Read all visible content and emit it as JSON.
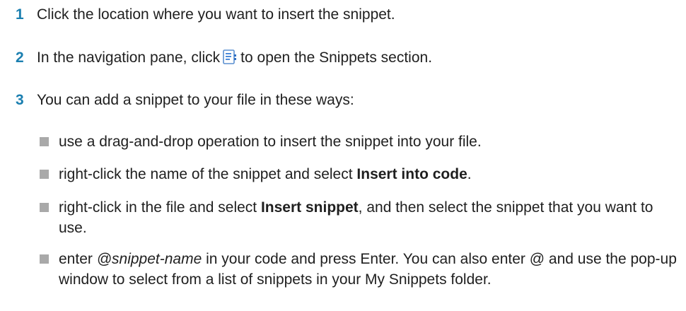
{
  "steps": [
    {
      "number": "1",
      "text": "Click the location where you want to insert the snippet."
    },
    {
      "number": "2",
      "text_before": "In the navigation pane, click",
      "icon": "snippets-icon",
      "text_after": "to open the Snippets section."
    },
    {
      "number": "3",
      "text": "You can add a snippet to your file in these ways:"
    }
  ],
  "ways": [
    {
      "text": "use a drag-and-drop operation to insert the snippet into your file."
    },
    {
      "text_before": "right-click the name of the snippet and select ",
      "bold": "Insert into code",
      "text_after": "."
    },
    {
      "text_before": "right-click in the file and select ",
      "bold": "Insert snippet",
      "text_after": ", and then select the snippet that you want to use."
    },
    {
      "italic": "@snippet-name",
      "text_before": "enter ",
      "text_after": " in your code and press Enter. You can also enter @ and use the pop-up window to select from a list of snippets in your My Snippets folder."
    }
  ],
  "colors": {
    "step_number": "#1b7fb0",
    "bullet": "#a9a9a9",
    "icon_blue": "#3a7fd6"
  }
}
